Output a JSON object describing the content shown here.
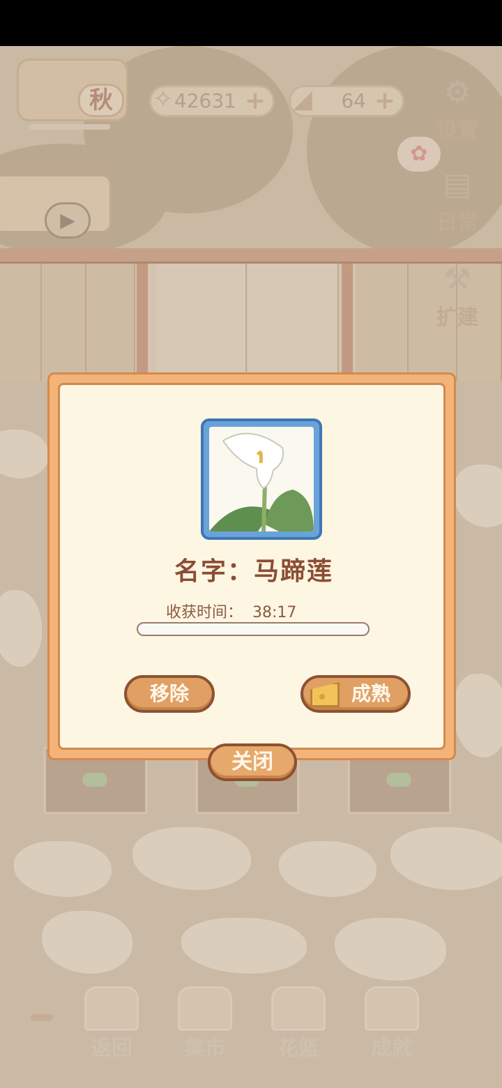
{
  "hud": {
    "season": "秋",
    "fish_coins": "42631",
    "cheese": "64",
    "plus_glyph": "+"
  },
  "side_buttons": {
    "settings": "设置",
    "daily": "日常",
    "expand": "扩建"
  },
  "dialog": {
    "plant_name_line": "名字：马蹄莲",
    "harvest_label": "收获时间：",
    "harvest_time": "38:17",
    "growth_progress": 0,
    "remove_button": "移除",
    "ripen_button": "成熟",
    "close_button": "关闭"
  },
  "bottom_nav": {
    "back": "返回",
    "market": "集市",
    "basket": "花篮",
    "achievements": "成就"
  },
  "colors": {
    "dialog_outer": "#f3b379",
    "dialog_inner": "#fdf6e2",
    "button": "#e0a064",
    "frame_blue": "#3f77b3",
    "title_text": "#8a4d34"
  }
}
